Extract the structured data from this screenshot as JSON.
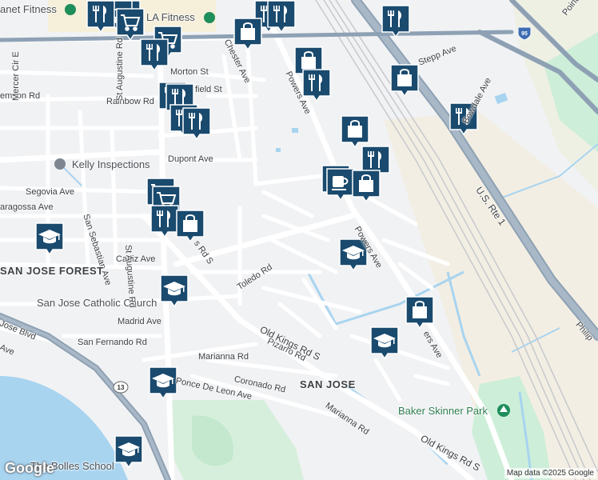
{
  "labels": {
    "planet_fitness": "anet Fitness",
    "la_fitness": "LA Fitness",
    "chester_ave": "Chester Ave",
    "morton_st": "Morton St",
    "field_st": "field St",
    "emson_rd": "emson Rd",
    "rainbow_rd": "Rainbow Rd",
    "mercer_cir_e": "Mercer Cir E",
    "dupont_ave": "Dupont Ave",
    "kelly_inspections": "Kelly Inspections",
    "segovia_ave": "Segovia Ave",
    "aragossa_ave": "aragossa Ave",
    "san_sebastian_ave": "San Sebastian Ave",
    "cadiz_ave": "Cadiz Ave",
    "san_jose_forest": "SAN JOSE FOREST",
    "san_jose_catholic_church": "San Jose Catholic Church",
    "toledo_rd": "Toledo Rd",
    "madrid_ave": "Madrid Ave",
    "jose_blvd": "Jose Blvd",
    "san_fernando_rd": "San Fernando Rd",
    "ave_left": "Ave",
    "marianna_rd_1": "Marianna Rd",
    "pizarro_rd": "Pizarro Rd",
    "old_kings_rd_s_1": "Old Kings Rd S",
    "coronado_rd": "Coronado Rd",
    "ponce_de_leon_ave": "Ponce De Leon Ave",
    "san_jose": "SAN JOSE",
    "marianna_rd_2": "Marianna Rd",
    "old_kings_rd_s_2": "Old Kings Rd S",
    "baker_skinner_park": "Baker Skinner Park",
    "the_bolles_school": "The Bolles School",
    "powers_ave_1": "Powers Ave",
    "powers_ave_2": "Powers Ave",
    "ers_ave": "ers Ave",
    "stepp_ave": "Stepp Ave",
    "bowdale_ave": "Bowdale Ave",
    "us_rte_1": "U.S. Rte 1",
    "point_pkwy": "Point Pkwy",
    "philips": "Philip",
    "st_augustine_rd_top": "St Augustine Rd",
    "st_augustine_rd_lower": "St Augustine Rd",
    "rd_s": "s Rd S",
    "shield_95": "95",
    "shield_13": "13"
  },
  "attribution": "Map data ©2025 Google",
  "logo": "Google",
  "colors": {
    "land": "#f1f2f4",
    "water": "#a8d4f0",
    "park": "#cdeed8",
    "highway": "#8ea1b4",
    "road": "#ffffff",
    "marker": "#1a4a6e"
  }
}
